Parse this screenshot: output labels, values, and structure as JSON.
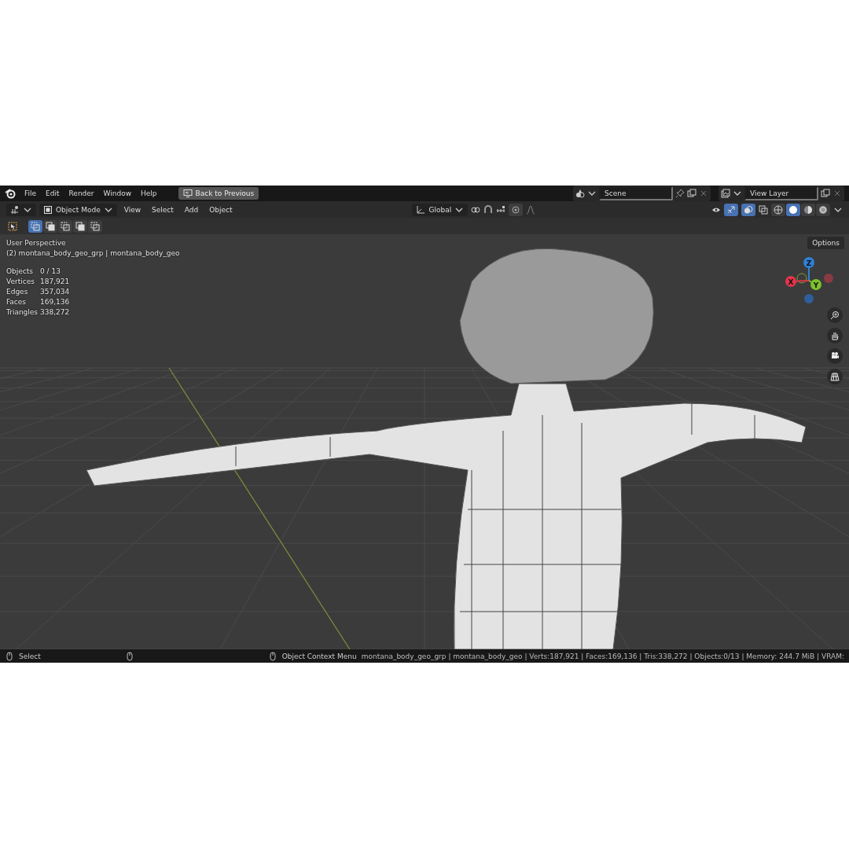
{
  "topbar": {
    "menus": [
      "File",
      "Edit",
      "Render",
      "Window",
      "Help"
    ],
    "back_button": "Back to Previous",
    "scene": {
      "value": "Scene"
    },
    "view_layer": {
      "value": "View Layer"
    }
  },
  "header": {
    "mode": "Object Mode",
    "menus": [
      "View",
      "Select",
      "Add",
      "Object"
    ],
    "orientation": "Global",
    "proportional_on": false,
    "overlays_on": true,
    "gizmos_on": true,
    "shading": [
      {
        "kind": "wireframe",
        "selected": false
      },
      {
        "kind": "solid",
        "selected": true
      },
      {
        "kind": "material",
        "selected": false
      },
      {
        "kind": "rendered",
        "selected": false
      }
    ]
  },
  "tool_row": {
    "select_modes": [
      {
        "selected": true
      },
      {
        "selected": false
      },
      {
        "selected": false
      },
      {
        "selected": false
      },
      {
        "selected": false
      }
    ]
  },
  "viewport": {
    "options": "Options",
    "perspective": "User Perspective",
    "object_info": "(2) montana_body_geo_grp | montana_body_geo",
    "stats": [
      {
        "label": "Objects",
        "value": "0 / 13"
      },
      {
        "label": "Vertices",
        "value": "187,921"
      },
      {
        "label": "Edges",
        "value": "357,034"
      },
      {
        "label": "Faces",
        "value": "169,136"
      },
      {
        "label": "Triangles",
        "value": "338,272"
      }
    ],
    "gizmo": [
      {
        "axis": "Z",
        "color": "#2f7fd6"
      },
      {
        "axis": "X",
        "color": "#e0354b"
      },
      {
        "axis": "Y",
        "color": "#7dc12a"
      }
    ]
  },
  "status_bar": {
    "left": [
      "Select",
      "Object Context Menu"
    ],
    "info": "montana_body_geo_grp | montana_body_geo | Verts:187,921 | Faces:169,136 | Tris:338,272 | Objects:0/13 | Memory: 244.7 MiB | VRAM:"
  }
}
